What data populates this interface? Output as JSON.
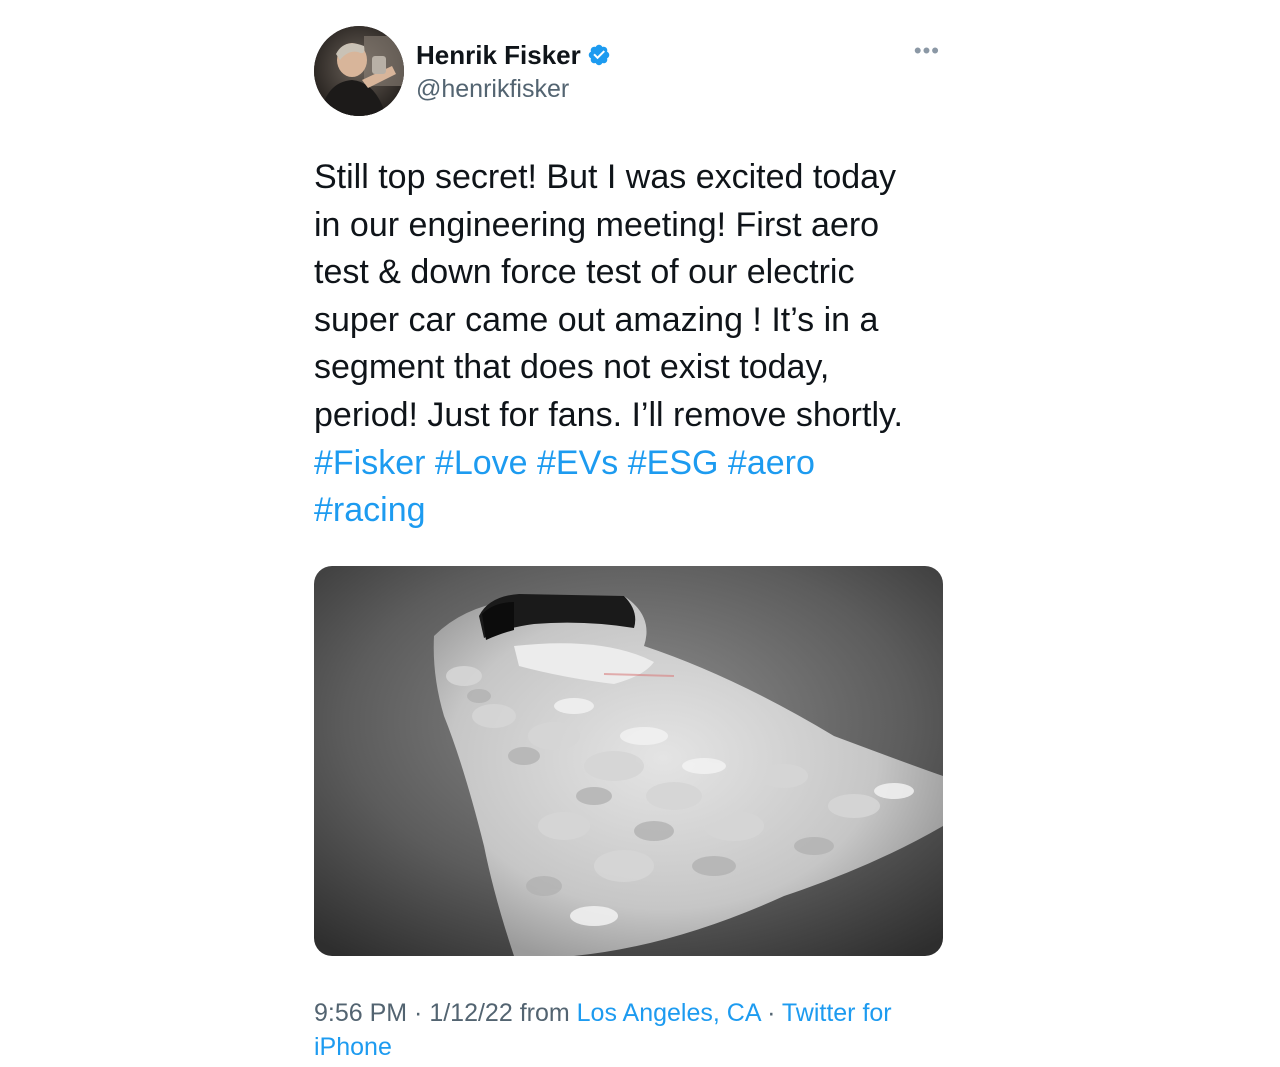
{
  "author": {
    "display_name": "Henrik Fisker",
    "handle": "@henrikfisker",
    "verified_icon": "verified-badge-icon",
    "verified_color": "#1d9bf0"
  },
  "more_icon": "more-options-icon",
  "text_lines": [
    "Still top secret! But I was excited today",
    "in our engineering meeting! First aero",
    "test & down force test of our electric",
    "super car came out amazing ! It’s in a",
    "segment that does not exist today,",
    "period! Just for fans. I’ll remove shortly."
  ],
  "hashtags_line1": [
    "#Fisker",
    "#Love",
    "#EVs",
    "#ESG",
    "#aero"
  ],
  "hashtags_line2": [
    "#racing"
  ],
  "meta": {
    "time": "9:56 PM",
    "sep1": " · ",
    "date": "1/12/22",
    "from": " from ",
    "location": "Los Angeles, CA",
    "sep2": " · ",
    "source_part1": "Twitter for",
    "source_part2": "iPhone"
  },
  "colors": {
    "text": "#0f1419",
    "secondary": "#536471",
    "accent": "#1d9bf0"
  }
}
